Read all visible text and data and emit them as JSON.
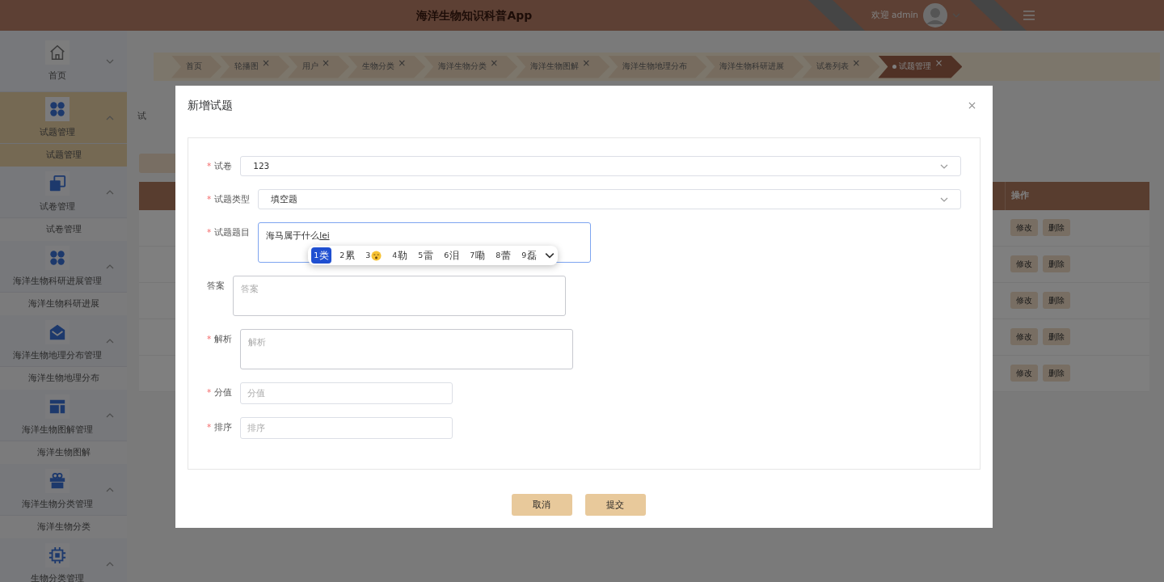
{
  "header": {
    "title": "海洋生物知识科普App",
    "welcome": "欢迎 admin"
  },
  "sidebar": {
    "items": [
      {
        "label": "首页",
        "kind": "home",
        "expanded": false,
        "selected": false
      },
      {
        "label": "试题管理",
        "kind": "grid",
        "expanded": true,
        "selected": true,
        "children": [
          {
            "label": "试题管理",
            "selected": true
          }
        ]
      },
      {
        "label": "试卷管理",
        "kind": "copy",
        "expanded": true,
        "selected": false,
        "children": [
          {
            "label": "试卷管理",
            "selected": false
          }
        ]
      },
      {
        "label": "海洋生物科研进展管理",
        "kind": "grid",
        "expanded": true,
        "selected": false,
        "children": [
          {
            "label": "海洋生物科研进展",
            "selected": false
          }
        ]
      },
      {
        "label": "海洋生物地理分布管理",
        "kind": "mail",
        "expanded": true,
        "selected": false,
        "children": [
          {
            "label": "海洋生物地理分布",
            "selected": false
          }
        ]
      },
      {
        "label": "海洋生物图解管理",
        "kind": "layout",
        "expanded": true,
        "selected": false,
        "children": [
          {
            "label": "海洋生物图解",
            "selected": false
          }
        ]
      },
      {
        "label": "海洋生物分类管理",
        "kind": "gift",
        "expanded": true,
        "selected": false,
        "children": [
          {
            "label": "海洋生物分类",
            "selected": false
          }
        ]
      },
      {
        "label": "生物分类管理",
        "kind": "chip",
        "expanded": true,
        "selected": false
      }
    ]
  },
  "tags": [
    {
      "label": "首页",
      "closable": false,
      "selected": false
    },
    {
      "label": "轮播图",
      "closable": true,
      "selected": false
    },
    {
      "label": "用户",
      "closable": true,
      "selected": false
    },
    {
      "label": "生物分类",
      "closable": true,
      "selected": false
    },
    {
      "label": "海洋生物分类",
      "closable": true,
      "selected": false
    },
    {
      "label": "海洋生物图解",
      "closable": true,
      "selected": false
    },
    {
      "label": "海洋生物地理分布",
      "closable": false,
      "selected": false
    },
    {
      "label": "海洋生物科研进展",
      "closable": false,
      "selected": false
    },
    {
      "label": "试卷列表",
      "closable": true,
      "selected": false
    },
    {
      "label": "试题管理",
      "closable": true,
      "selected": true
    }
  ],
  "close_glyph": "×",
  "page": {
    "title_fragment": "试",
    "table": {
      "action_header": "操作",
      "rows": [
        {
          "actions": [
            "修改",
            "删除"
          ]
        },
        {
          "actions": [
            "修改",
            "删除"
          ]
        },
        {
          "actions": [
            "修改",
            "删除"
          ]
        },
        {
          "actions": [
            "修改",
            "删除"
          ]
        },
        {
          "actions": [
            "修改",
            "删除"
          ]
        }
      ]
    }
  },
  "modal": {
    "title": "新增试题",
    "required_mark": "*",
    "fields": [
      {
        "label": "试卷",
        "required": true,
        "kind": "select",
        "value": "123"
      },
      {
        "label": "试题类型",
        "required": true,
        "kind": "select",
        "value": "填空题"
      },
      {
        "label": "试题题目",
        "required": true,
        "kind": "textarea",
        "value": "海马属于什么",
        "composition": "lei",
        "focused": true
      },
      {
        "label": "答案",
        "required": false,
        "kind": "textarea",
        "placeholder": "答案",
        "focused": false
      },
      {
        "label": "解析",
        "required": true,
        "kind": "textarea",
        "placeholder": "解析",
        "focused": false
      },
      {
        "label": "分值",
        "required": true,
        "kind": "input",
        "placeholder": "分值",
        "focused": false
      },
      {
        "label": "排序",
        "required": true,
        "kind": "input",
        "placeholder": "排序",
        "focused": false
      }
    ],
    "ime": {
      "candidates": [
        {
          "index": "1",
          "kind": "text",
          "char": "类",
          "selected": true
        },
        {
          "index": "2",
          "kind": "text",
          "char": "累",
          "selected": false
        },
        {
          "index": "3",
          "kind": "emoji",
          "selected": false
        },
        {
          "index": "4",
          "kind": "text",
          "char": "勒",
          "selected": false
        },
        {
          "index": "5",
          "kind": "text",
          "char": "雷",
          "selected": false
        },
        {
          "index": "6",
          "kind": "text",
          "char": "泪",
          "selected": false
        },
        {
          "index": "7",
          "kind": "text",
          "char": "嘞",
          "selected": false
        },
        {
          "index": "8",
          "kind": "text",
          "char": "蕾",
          "selected": false
        },
        {
          "index": "9",
          "kind": "text",
          "char": "磊",
          "selected": false
        }
      ]
    },
    "buttons": [
      "取消",
      "提交"
    ]
  }
}
